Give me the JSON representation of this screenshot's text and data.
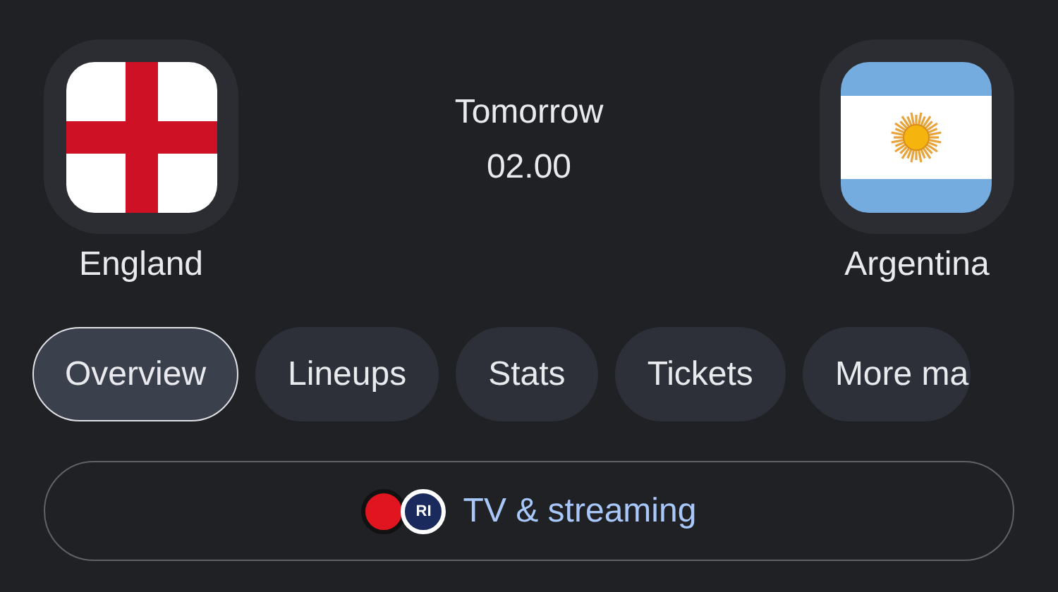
{
  "home_team": {
    "name": "England",
    "kind": "england"
  },
  "match": {
    "day": "Tomorrow",
    "time": "02.00"
  },
  "away_team": {
    "name": "Argentina",
    "kind": "argentina"
  },
  "tabs": [
    {
      "label": "Overview",
      "selected": true
    },
    {
      "label": "Lineups",
      "selected": false
    },
    {
      "label": "Stats",
      "selected": false
    },
    {
      "label": "Tickets",
      "selected": false
    },
    {
      "label": "More ma",
      "selected": false
    }
  ],
  "tv_button": {
    "label": "TV & streaming",
    "channel_logos": [
      {
        "kind": "red"
      },
      {
        "kind": "navy",
        "text": "RI"
      }
    ]
  }
}
